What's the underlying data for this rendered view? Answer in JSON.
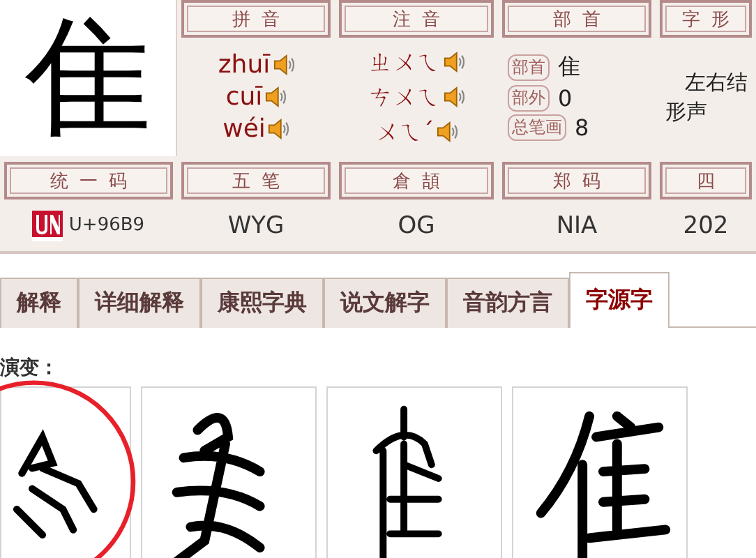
{
  "glyph": "隹",
  "pinyin": {
    "header": "拼音",
    "readings": [
      "zhuī",
      "cuī",
      "wéi"
    ]
  },
  "zhuyin": {
    "header": "注音",
    "readings": [
      "ㄓㄨㄟ",
      "ㄘㄨㄟ",
      "ㄨㄟˊ"
    ]
  },
  "radical": {
    "header": "部首",
    "rows": [
      {
        "label": "部首",
        "value": "隹"
      },
      {
        "label": "部外",
        "value": "0"
      },
      {
        "label": "总笔画",
        "value": "8"
      }
    ]
  },
  "structure": {
    "header": "字形",
    "lines": [
      "左右结",
      "形声"
    ]
  },
  "codes": [
    {
      "header": "统一码",
      "value": "U+96B9",
      "kind": "unicode"
    },
    {
      "header": "五笔",
      "value": "WYG",
      "kind": "plain"
    },
    {
      "header": "倉頡",
      "value": "OG",
      "kind": "plain"
    },
    {
      "header": "郑码",
      "value": "NIA",
      "kind": "plain"
    },
    {
      "header": "四",
      "value": "202",
      "kind": "plain"
    }
  ],
  "tabs": [
    {
      "label": "解释",
      "selected": false
    },
    {
      "label": "详细解释",
      "selected": false
    },
    {
      "label": "康熙字典",
      "selected": false
    },
    {
      "label": "说文解字",
      "selected": false
    },
    {
      "label": "音韵方言",
      "selected": false
    },
    {
      "label": "字源字",
      "selected": true
    }
  ],
  "evolution": {
    "title": "演变：",
    "forms": [
      {
        "kind": "oracle",
        "circled": true
      },
      {
        "kind": "bronze",
        "circled": false
      },
      {
        "kind": "seal",
        "circled": false
      },
      {
        "kind": "regular",
        "circled": false
      }
    ]
  }
}
